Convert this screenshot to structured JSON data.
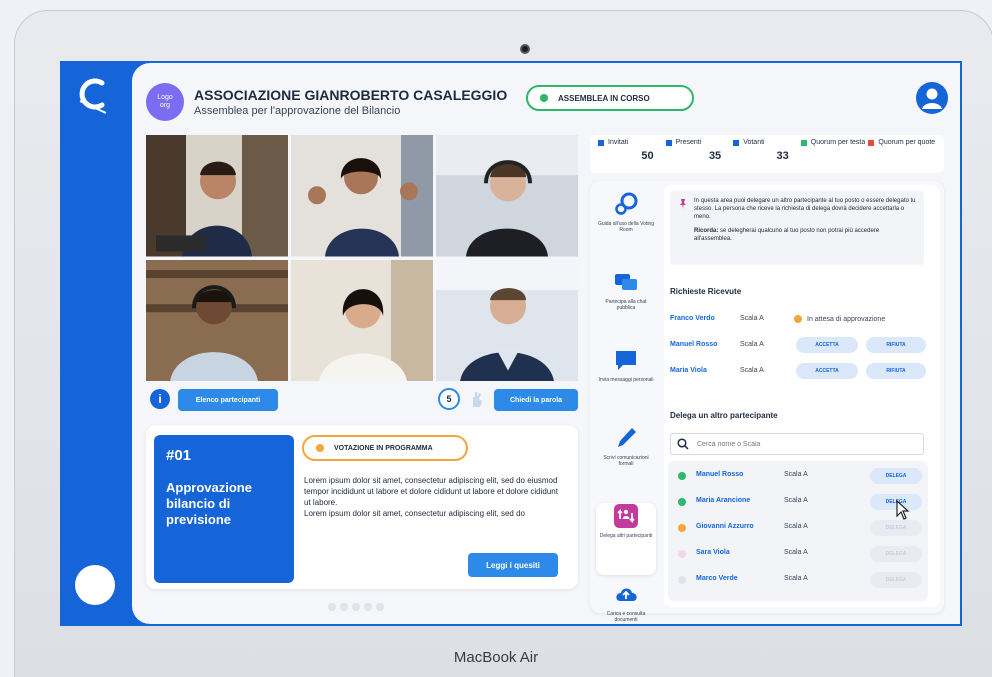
{
  "device": {
    "brand": "MacBook Air"
  },
  "header": {
    "logo_text": "Logo\norg",
    "org_name": "ASSOCIAZIONE GIANROBERTO CASALEGGIO",
    "subtitle": "Assemblea per l'approvazione del Bilancio",
    "status": "ASSEMBLEA IN CORSO"
  },
  "toolbar": {
    "info": "i",
    "participants_button": "Elenco partecipanti",
    "raised_hands": "5",
    "speak_button": "Chiedi la parola"
  },
  "vote": {
    "number": "#01",
    "title": "Approvazione bilancio di previsione",
    "status": "VOTAZIONE IN PROGRAMMA",
    "text": "Lorem ipsum dolor sit amet, consectetur adipiscing elit, sed do eiusmod tempor incididunt ut labore et dolore cididunt ut labore et dolore cididunt ut labore.\nLorem ipsum dolor sit amet, consectetur adipiscing elit, sed do",
    "read_button": "Leggi i quesiti"
  },
  "stats": [
    {
      "label": "Invitati",
      "value": "50",
      "color": "#1565d8"
    },
    {
      "label": "Presenti",
      "value": "35",
      "color": "#1565d8"
    },
    {
      "label": "Votanti",
      "value": "33",
      "color": "#1565d8"
    },
    {
      "label": "Quorum per testa",
      "value": "",
      "color": "#2eb66a"
    },
    {
      "label": "Quorum per quote",
      "value": "",
      "color": "#e84a3a"
    }
  ],
  "menu": [
    {
      "label": "Guida all'uso della Voting Room",
      "icon": "gears-icon"
    },
    {
      "label": "Partecipa alla chat pubblica",
      "icon": "chat-icon"
    },
    {
      "label": "Invia messaggi personali",
      "icon": "message-icon"
    },
    {
      "label": "Scrivi comunicazioni formali",
      "icon": "pen-icon"
    },
    {
      "label": "Delega altri partecipanti",
      "icon": "delegate-icon"
    },
    {
      "label": "Carica e consulta documenti",
      "icon": "cloud-upload-icon"
    }
  ],
  "delegation": {
    "notice": "In questa area puoi delegare un altro partecipante al tuo posto o essere delegato tu stesso. La persona che riceve la richiesta di delega dovrà decidere accettarla o meno.",
    "notice_bold": "Ricorda:",
    "notice_rest": "se delegherai qualcuno al tuo posto non potrai più accedere all'assemblea.",
    "received_title": "Richieste Ricevute",
    "requests": [
      {
        "name": "Franco Verdo",
        "scala": "Scala A",
        "status": "In attesa di approvazione",
        "accept": "",
        "refuse": ""
      },
      {
        "name": "Manuel Rosso",
        "scala": "Scala A",
        "status": "",
        "accept": "ACCETTA",
        "refuse": "RIFIUTA"
      },
      {
        "name": "Maria Viola",
        "scala": "Scala A",
        "status": "",
        "accept": "ACCETTA",
        "refuse": "RIFIUTA"
      }
    ],
    "delegate_title": "Delega un altro partecipante",
    "search_placeholder": "Cerca nome o Scala",
    "participants": [
      {
        "name": "Manuel Rosso",
        "scala": "Scala A",
        "button": "DELEGA",
        "dot": "#2eb66a",
        "enabled": true
      },
      {
        "name": "Maria Arancione",
        "scala": "Scala A",
        "button": "DELEGA",
        "dot": "#2eb66a",
        "enabled": true
      },
      {
        "name": "Giovanni Azzurro",
        "scala": "Scala A",
        "button": "DELEGA",
        "dot": "#f4a63a",
        "enabled": false
      },
      {
        "name": "Sara Viola",
        "scala": "Scala A",
        "button": "DELEGA",
        "dot": "#f3d7ef",
        "enabled": false
      },
      {
        "name": "Marco Verde",
        "scala": "Scala A",
        "button": "DELEGA",
        "dot": "#dfe3ea",
        "enabled": false
      }
    ]
  },
  "colors": {
    "brand": "#1565d8",
    "accent": "#2d8ae8",
    "live": "#2eb66a",
    "scheduled": "#f4a63a"
  }
}
